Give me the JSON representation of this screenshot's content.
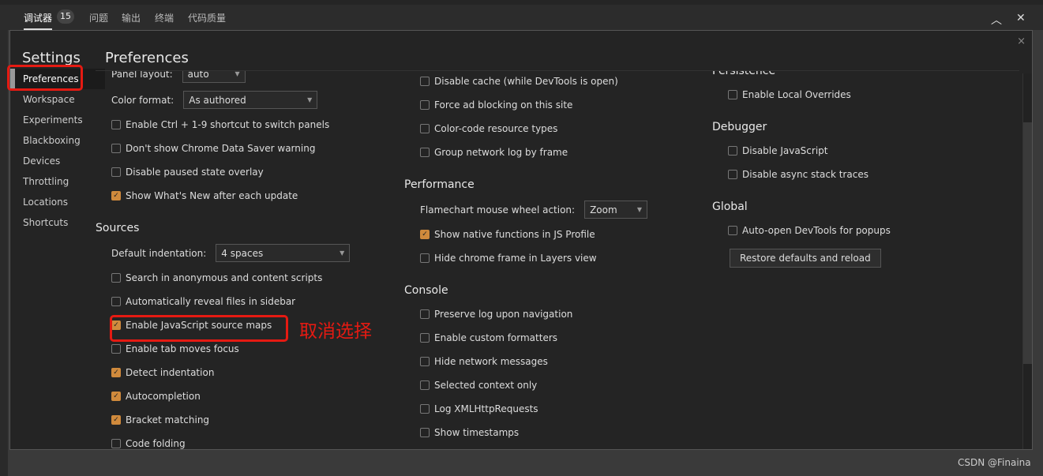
{
  "topbar": {
    "tabs": [
      "调试器",
      "问题",
      "输出",
      "终端",
      "代码质量"
    ],
    "badge": "15",
    "icons": [
      "chevron-up-icon",
      "close-icon"
    ]
  },
  "dialog": {
    "settings_title": "Settings",
    "page_title": "Preferences",
    "close": "×"
  },
  "sidebar": {
    "items": [
      "Preferences",
      "Workspace",
      "Experiments",
      "Blackboxing",
      "Devices",
      "Throttling",
      "Locations",
      "Shortcuts"
    ],
    "active": "Preferences"
  },
  "columns": [
    [
      {
        "type": "select",
        "label": "Panel layout:",
        "value": "auto"
      },
      {
        "type": "select",
        "label": "Color format:",
        "value": "As authored"
      },
      {
        "type": "check",
        "label": "Enable Ctrl + 1-9 shortcut to switch panels",
        "checked": false
      },
      {
        "type": "check",
        "label": "Don't show Chrome Data Saver warning",
        "checked": false
      },
      {
        "type": "check",
        "label": "Disable paused state overlay",
        "checked": false
      },
      {
        "type": "check",
        "label": "Show What's New after each update",
        "checked": true
      },
      {
        "type": "header",
        "label": "Sources"
      },
      {
        "type": "select",
        "label": "Default indentation:",
        "value": "4 spaces"
      },
      {
        "type": "check",
        "label": "Search in anonymous and content scripts",
        "checked": false
      },
      {
        "type": "check",
        "label": "Automatically reveal files in sidebar",
        "checked": false
      },
      {
        "type": "check",
        "label": "Enable JavaScript source maps",
        "checked": true
      },
      {
        "type": "check",
        "label": "Enable tab moves focus",
        "checked": false
      },
      {
        "type": "check",
        "label": "Detect indentation",
        "checked": true
      },
      {
        "type": "check",
        "label": "Autocompletion",
        "checked": true
      },
      {
        "type": "check",
        "label": "Bracket matching",
        "checked": true
      },
      {
        "type": "check",
        "label": "Code folding",
        "checked": false
      }
    ],
    [
      {
        "type": "check",
        "label": "Disable cache (while DevTools is open)",
        "checked": false
      },
      {
        "type": "check",
        "label": "Force ad blocking on this site",
        "checked": false
      },
      {
        "type": "check",
        "label": "Color-code resource types",
        "checked": false
      },
      {
        "type": "check",
        "label": "Group network log by frame",
        "checked": false
      },
      {
        "type": "header",
        "label": "Performance"
      },
      {
        "type": "select",
        "label": "Flamechart mouse wheel action:",
        "value": "Zoom"
      },
      {
        "type": "check",
        "label": "Show native functions in JS Profile",
        "checked": true
      },
      {
        "type": "check",
        "label": "Hide chrome frame in Layers view",
        "checked": false
      },
      {
        "type": "header",
        "label": "Console"
      },
      {
        "type": "check",
        "label": "Preserve log upon navigation",
        "checked": false
      },
      {
        "type": "check",
        "label": "Enable custom formatters",
        "checked": false
      },
      {
        "type": "check",
        "label": "Hide network messages",
        "checked": false
      },
      {
        "type": "check",
        "label": "Selected context only",
        "checked": false
      },
      {
        "type": "check",
        "label": "Log XMLHttpRequests",
        "checked": false
      },
      {
        "type": "check",
        "label": "Show timestamps",
        "checked": false
      },
      {
        "type": "check",
        "label": "",
        "checked": true
      }
    ],
    [
      {
        "type": "header",
        "label": "Persistence"
      },
      {
        "type": "check",
        "label": "Enable Local Overrides",
        "checked": false
      },
      {
        "type": "header",
        "label": "Debugger"
      },
      {
        "type": "check",
        "label": "Disable JavaScript",
        "checked": false
      },
      {
        "type": "check",
        "label": "Disable async stack traces",
        "checked": false
      },
      {
        "type": "header",
        "label": "Global"
      },
      {
        "type": "check",
        "label": "Auto-open DevTools for popups",
        "checked": false
      },
      {
        "type": "button",
        "label": "Restore defaults and reload"
      }
    ]
  ],
  "annotation": "取消选择",
  "watermark": "CSDN @Finaina",
  "colors": {
    "accent": "#d08a3c",
    "highlight": "#e51a12"
  }
}
